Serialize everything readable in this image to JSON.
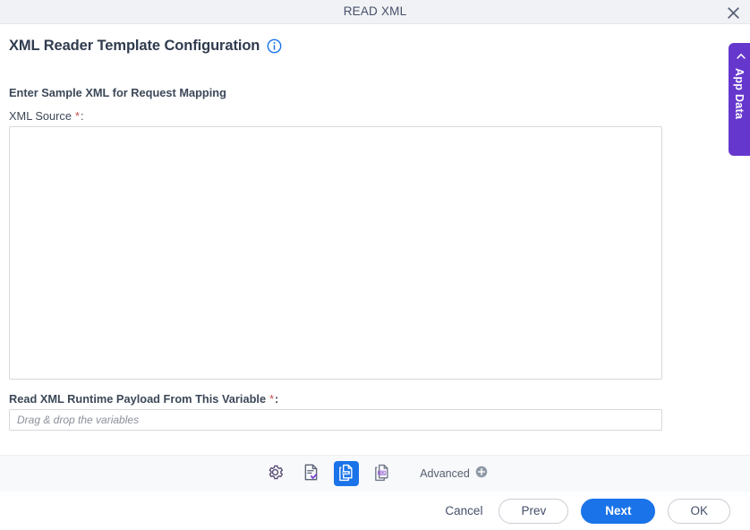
{
  "window": {
    "title": "READ XML",
    "close_icon": "close-icon"
  },
  "header": {
    "title": "XML Reader Template Configuration",
    "info_icon": "info-icon"
  },
  "form": {
    "section_label": "Enter Sample XML for Request Mapping",
    "xml_source": {
      "label": "XML Source",
      "required_marker": "*",
      "colon": ":",
      "value": "",
      "placeholder": ""
    },
    "runtime_variable": {
      "label": "Read XML Runtime Payload From This Variable",
      "required_marker": "*",
      "colon": ":",
      "value": "",
      "placeholder": "Drag & drop the variables"
    }
  },
  "side_panel": {
    "label": "App Data",
    "collapse_icon": "chevron-left-icon"
  },
  "toolbar": {
    "items": [
      {
        "name": "settings-gear-icon",
        "label": "",
        "active": false
      },
      {
        "name": "document-check-icon",
        "label": "",
        "active": false
      },
      {
        "name": "xml-file-icon-active",
        "label": "XML",
        "active": true
      },
      {
        "name": "xml-file-icon",
        "label": "XML",
        "active": false
      }
    ],
    "advanced_label": "Advanced",
    "advanced_icon": "plus-circle-icon"
  },
  "footer": {
    "cancel_label": "Cancel",
    "prev_label": "Prev",
    "next_label": "Next",
    "ok_label": "OK"
  },
  "colors": {
    "titlebar_bg": "#f1f2f5",
    "accent_blue": "#1a73e8",
    "accent_purple": "#6637cd",
    "required_red": "#c0504d",
    "toolbar_bg": "#f8f9fb",
    "text": "#3c4858",
    "border": "#d6d8dc"
  }
}
